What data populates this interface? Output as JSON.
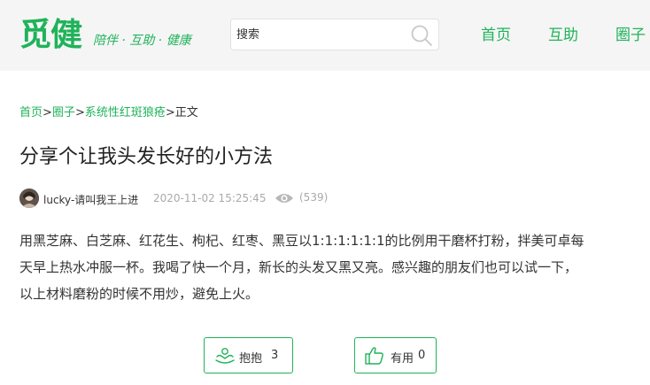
{
  "header": {
    "logo": "觅健",
    "slogan": "陪伴 · 互助 · 健康",
    "search_placeholder": "搜索",
    "nav": [
      "首页",
      "互助",
      "圈子"
    ]
  },
  "breadcrumb": {
    "home": "首页",
    "sep": ">",
    "circle": "圈子",
    "topic": "系统性红斑狼疮",
    "current": "正文"
  },
  "post": {
    "title": "分享个让我头发长好的小方法",
    "author": "lucky-请叫我王上进",
    "time": "2020-11-02 15:25:45",
    "views": "(539)",
    "content": [
      "用黑芝麻、白芝麻、红花生、枸杞、红枣、黑豆以1:1:1:1:1:1的比例用干磨杯打粉，拌美可卓每",
      "天早上热水冲服一杯。我喝了快一个月，新长的头发又黑又亮。感兴趣的朋友们也可以试一下，",
      "以上材料磨粉的时候不用炒，避免上火。"
    ]
  },
  "actions": {
    "hug_label": "抱抱",
    "hug_count": "3",
    "useful_label": "有用",
    "useful_count": "0"
  },
  "colors": {
    "brand": "#1fb35a",
    "muted": "#aaaaaa",
    "header_bg": "#f5f5f5"
  }
}
